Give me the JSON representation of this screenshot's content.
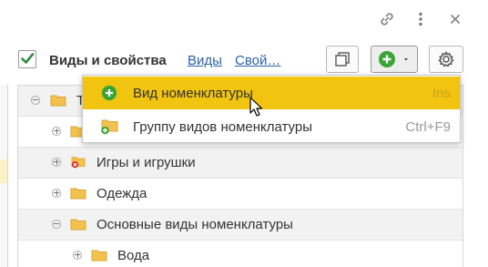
{
  "header": {
    "title": "Виды и свойства",
    "link_types": "Виды",
    "link_props": "Свой…"
  },
  "tree": {
    "rows": [
      {
        "label": "Т"
      },
      {
        "label": ""
      },
      {
        "label": "Игры и игрушки"
      },
      {
        "label": "Одежда"
      },
      {
        "label": "Основные виды номенклатуры"
      },
      {
        "label": "Вода"
      }
    ]
  },
  "menu": {
    "items": [
      {
        "label": "Вид номенклатуры",
        "shortcut": "Ins"
      },
      {
        "label": "Группу видов номенклатуры",
        "shortcut": "Ctrl+F9"
      }
    ]
  },
  "colors": {
    "accent": "#f0c40f",
    "link": "#2a62b0",
    "add_green": "#3aa535",
    "folder": "#f2c14e",
    "error_red": "#d9322b"
  }
}
